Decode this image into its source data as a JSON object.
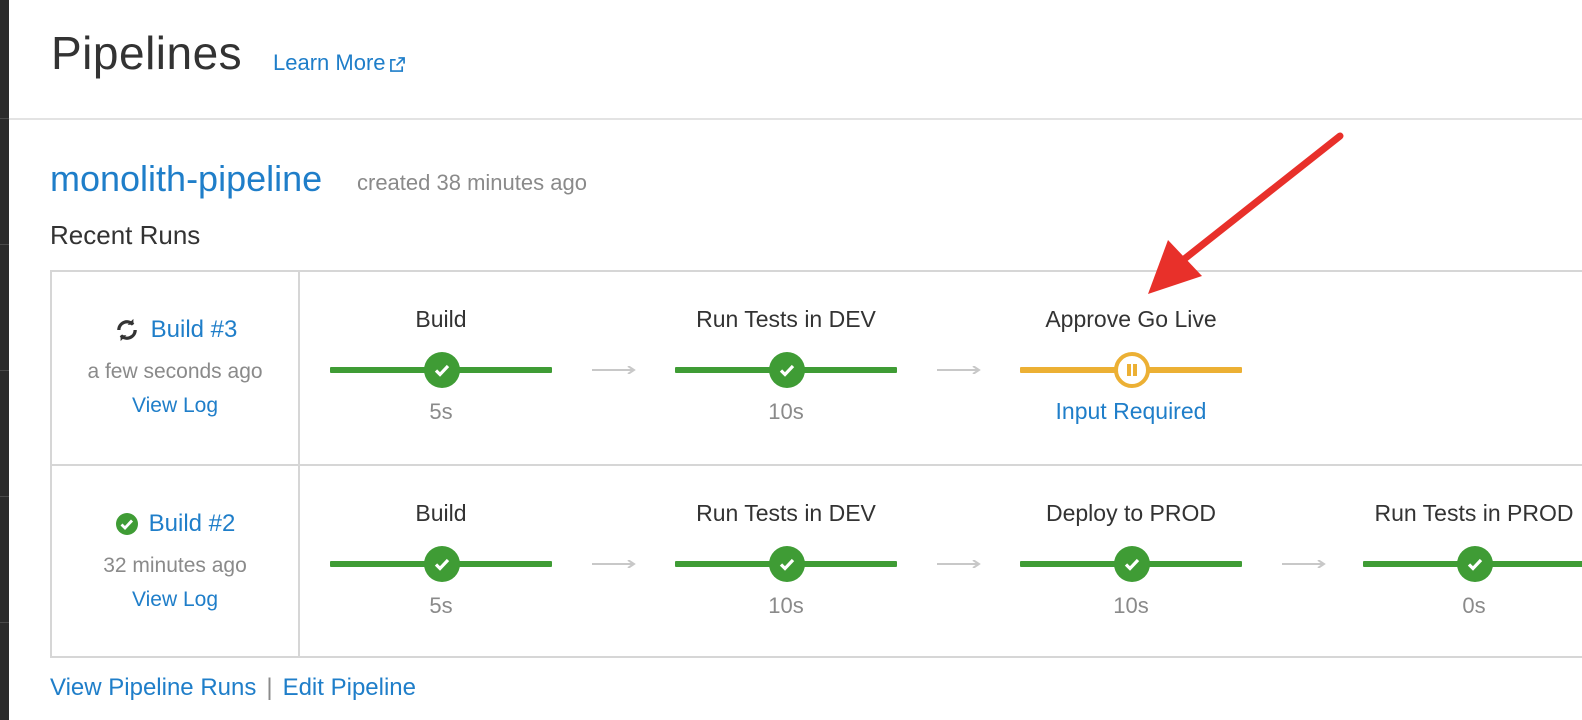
{
  "header": {
    "title": "Pipelines",
    "learn_more": "Learn More"
  },
  "pipeline": {
    "name": "monolith-pipeline",
    "created": "created 38 minutes ago",
    "recent_runs_label": "Recent Runs"
  },
  "runs": [
    {
      "build": "Build #3",
      "status_icon": "sync-icon",
      "time": "a few seconds ago",
      "view_log": "View Log",
      "stages": [
        {
          "name": "Build",
          "status": "success",
          "duration": "5s"
        },
        {
          "name": "Run Tests in DEV",
          "status": "success",
          "duration": "10s"
        },
        {
          "name": "Approve Go Live",
          "status": "pending",
          "input": "Input Required"
        }
      ]
    },
    {
      "build": "Build #2",
      "status_icon": "check-circle-icon",
      "time": "32 minutes ago",
      "view_log": "View Log",
      "stages": [
        {
          "name": "Build",
          "status": "success",
          "duration": "5s"
        },
        {
          "name": "Run Tests in DEV",
          "status": "success",
          "duration": "10s"
        },
        {
          "name": "Deploy to PROD",
          "status": "success",
          "duration": "10s"
        },
        {
          "name": "Run Tests in PROD",
          "status": "success",
          "duration": "0s"
        }
      ]
    }
  ],
  "footer": {
    "view_runs": "View Pipeline Runs",
    "separator": "|",
    "edit": "Edit Pipeline"
  },
  "colors": {
    "link": "#1f7ec9",
    "success": "#3f9c35",
    "pending": "#ecb034",
    "annotation": "#e8302a"
  }
}
